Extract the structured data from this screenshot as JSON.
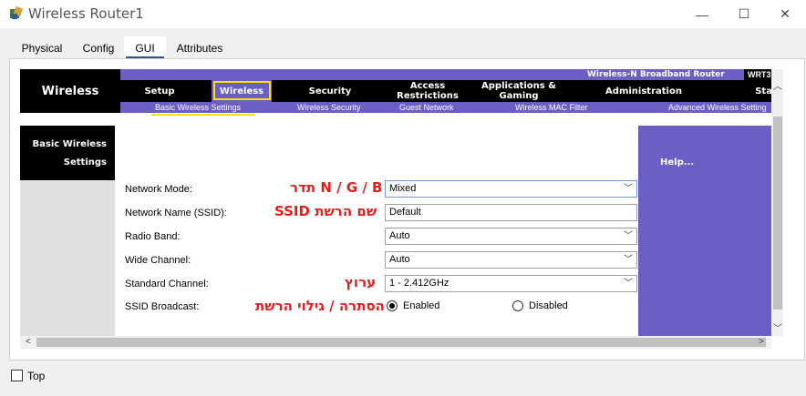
{
  "window": {
    "title": "Wireless Router1",
    "minimize_glyph": "—",
    "maximize_glyph": "☐",
    "close_glyph": "✕"
  },
  "tabs": [
    {
      "label": "Physical"
    },
    {
      "label": "Config"
    },
    {
      "label": "GUI"
    },
    {
      "label": "Attributes"
    }
  ],
  "router": {
    "brand": "Wireless",
    "product": "Wireless-N Broadband Router",
    "model": "WRT3",
    "nav": [
      {
        "label": "Setup"
      },
      {
        "label": "Wireless"
      },
      {
        "label": "Security"
      },
      {
        "label": "Access Restrictions"
      },
      {
        "label": "Applications & Gaming"
      },
      {
        "label": "Administration"
      },
      {
        "label": "Stat"
      }
    ],
    "subnav": [
      {
        "label": "Basic Wireless Settings"
      },
      {
        "label": "Wireless Security"
      },
      {
        "label": "Guest Network"
      },
      {
        "label": "Wireless MAC Filter"
      },
      {
        "label": "Advanced Wireless Setting"
      }
    ],
    "section_title_line1": "Basic Wireless",
    "section_title_line2": "Settings",
    "help_label": "Help..."
  },
  "form": {
    "network_mode": {
      "label": "Network Mode:",
      "value": "Mixed",
      "note": "N / G / B תדר"
    },
    "network_name": {
      "label": "Network Name (SSID):",
      "value": "Default",
      "note": "שם הרשת SSID"
    },
    "radio_band": {
      "label": "Radio Band:",
      "value": "Auto"
    },
    "wide_channel": {
      "label": "Wide Channel:",
      "value": "Auto"
    },
    "standard_channel": {
      "label": "Standard Channel:",
      "value": "1 - 2.412GHz",
      "note": "ערוץ"
    },
    "ssid_broadcast": {
      "label": "SSID Broadcast:",
      "enabled_label": "Enabled",
      "disabled_label": "Disabled",
      "selected": "Enabled",
      "note": "הסתרה / גילוי הרשת"
    }
  },
  "footer": {
    "top_label": "Top",
    "top_checked": false
  },
  "colors": {
    "router_purple": "#6b5fc6",
    "highlight_yellow": "#ffe100",
    "annotation_red": "#e0201c"
  }
}
